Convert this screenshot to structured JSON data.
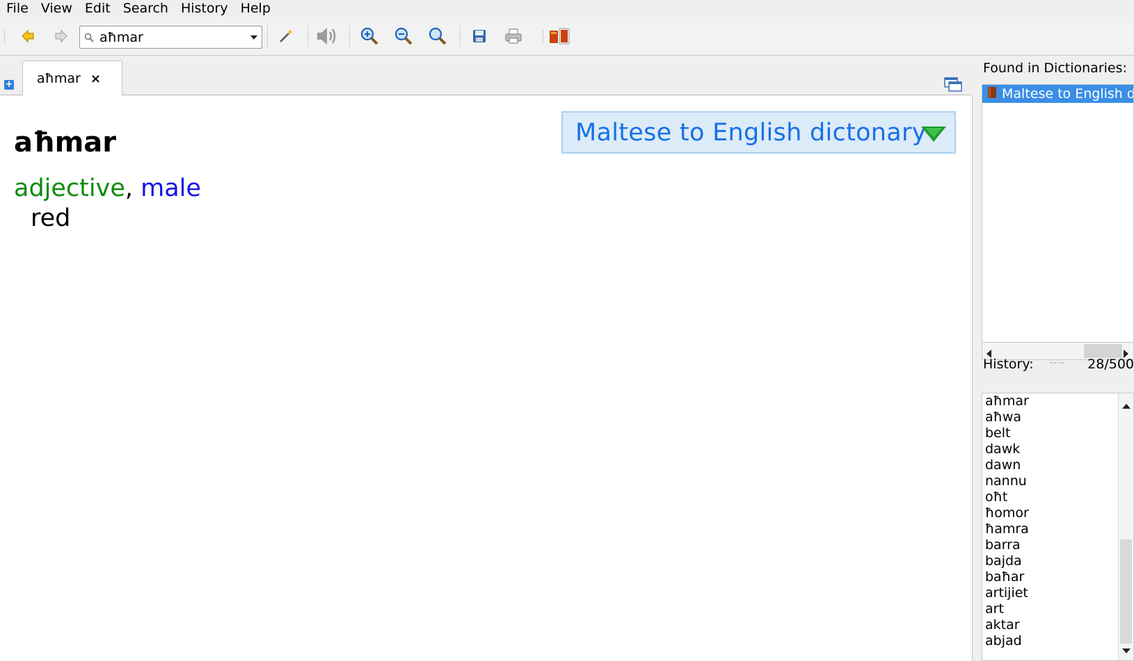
{
  "menu": {
    "file": "File",
    "view": "View",
    "edit": "Edit",
    "search": "Search",
    "history": "History",
    "help": "Help"
  },
  "toolbar": {
    "search_value": "aħmar"
  },
  "tabs": [
    {
      "label": "aħmar",
      "close": "×"
    }
  ],
  "article": {
    "dictionary_name": "Maltese to English dictonary",
    "headword": "aħmar",
    "part_of_speech": "adjective",
    "separator": ",",
    "gender": "male",
    "definition": "red"
  },
  "found_panel": {
    "title": "Found in Dictionaries:",
    "items": [
      {
        "label": "Maltese to English dictonary"
      }
    ]
  },
  "history_panel": {
    "title": "History:",
    "count": "28/500",
    "items": [
      "aħmar",
      "aħwa",
      "belt",
      "dawk",
      "dawn",
      "nannu",
      "oħt",
      "ħomor",
      "ħamra",
      "barra",
      "bajda",
      "baħar",
      "artijiet",
      "art",
      "aktar",
      "abjad"
    ]
  },
  "colors": {
    "part_of_speech": "#0a8a0a",
    "gender": "#1414e6",
    "dictionary_badge_text": "#1670e6",
    "selection": "#3a8ee6"
  }
}
